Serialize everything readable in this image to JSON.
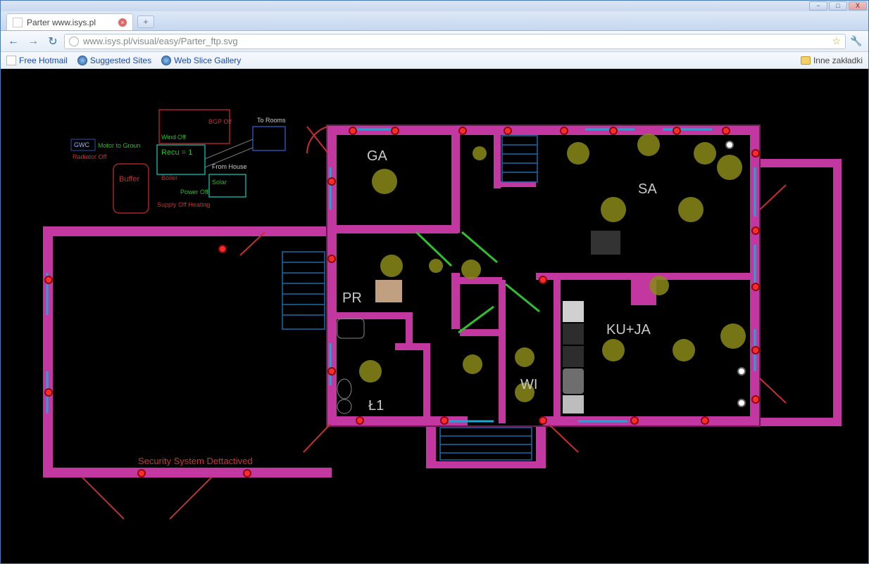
{
  "window": {
    "title": "Parter www.isys.pl",
    "minimize": "−",
    "maximize": "□",
    "close": "X"
  },
  "newtab": "+",
  "nav": {
    "back": "←",
    "forward": "→",
    "reload": "↻"
  },
  "url": "www.isys.pl/visual/easy/Parter_ftp.svg",
  "star": "☆",
  "wrench": "🔧",
  "bookmarks": {
    "b1": "Free Hotmail",
    "b2": "Suggested Sites",
    "b3": "Web Slice Gallery",
    "other": "Inne zakładki"
  },
  "floorplan": {
    "rooms": {
      "ga": "GA",
      "sa": "SA",
      "pr": "PR",
      "kuja": "KU+JA",
      "wi": "WI",
      "l1": "Ł1"
    },
    "hvac": {
      "to_rooms": "To Rooms",
      "from_house": "From House",
      "recu": "Recu = 1",
      "buffer_label": "Buffer",
      "boiler_label": "Boiler",
      "solar_label": "Solar",
      "bgp_off": "BGP Off",
      "wind_off": "Wind Off",
      "power_off": "Power Off",
      "gwc_label": "GWC",
      "supply_off": "Supply Off  Heating",
      "motor_ground": "Motor to Groun",
      "radiator_off": "Radiator Off"
    },
    "status_text": "Security System Dettactived",
    "colors": {
      "wall": "#c238a0",
      "light": "#8a8a1a",
      "sensor_ring": "#b01010",
      "sensor_core": "#ff2a2a",
      "door_open": "#2fbf2f",
      "door_red": "#c43030",
      "window": "#1aa8d6",
      "stairs": "#1a6aa8",
      "furniture": "#7a7a7a",
      "furniture_light": "#c0a080",
      "outline_cyan": "#0aa89a",
      "outline_red": "#aa2222"
    }
  }
}
